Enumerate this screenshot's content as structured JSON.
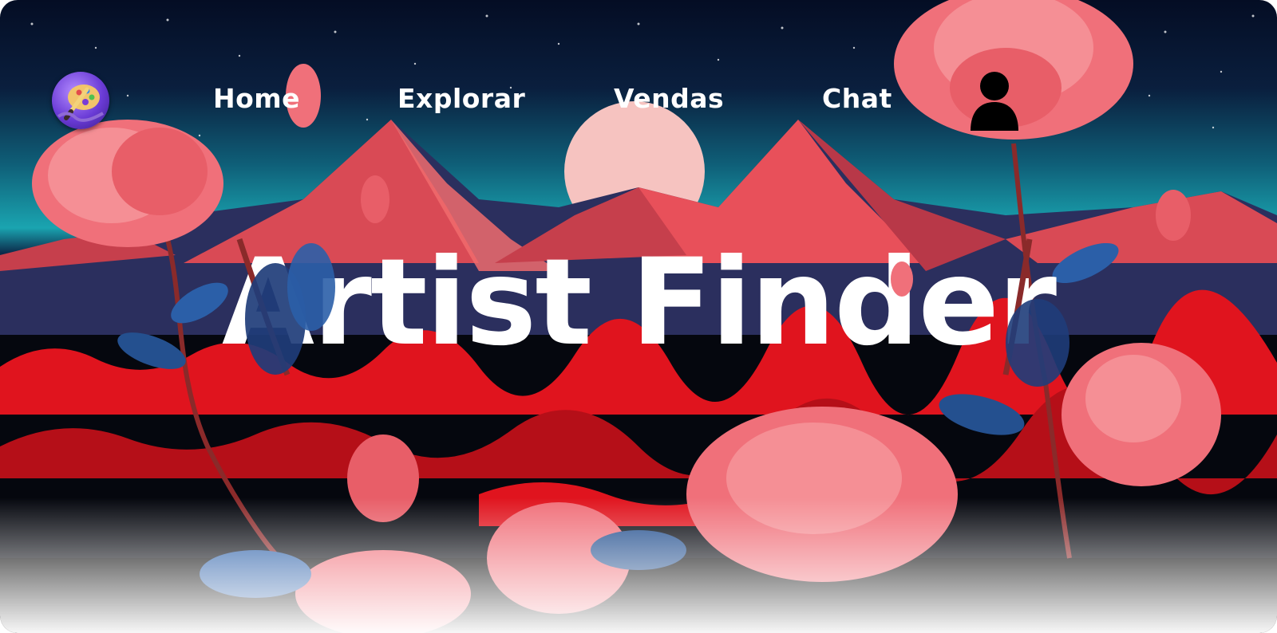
{
  "logo": {
    "icon": "artist-palette-icon"
  },
  "nav": {
    "links": [
      {
        "label": "Home"
      },
      {
        "label": "Explorar"
      },
      {
        "label": "Vendas"
      },
      {
        "label": "Chat"
      }
    ],
    "user_icon": "user-profile-icon"
  },
  "hero": {
    "title": "Artist Finder"
  },
  "colors": {
    "sky_top": "#040d24",
    "sky_horizon": "#1aa4b0",
    "sun": "#f6c3c0",
    "mountain": "#e8505a",
    "mountain_shadow": "#2b2f5e",
    "flower": "#f0707a",
    "leaf": "#2b5fa8",
    "foliage_red": "#e0141e"
  }
}
